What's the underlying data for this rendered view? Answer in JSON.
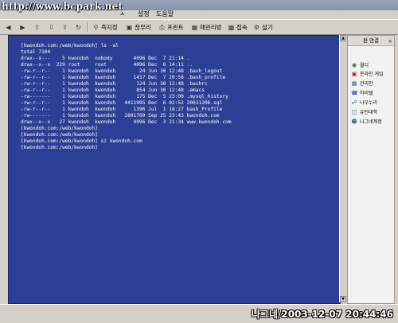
{
  "window": {
    "watermark": "http://www.bcpark.net"
  },
  "menu": [
    "ㅅ",
    "설정",
    "도움말"
  ],
  "toolbar": {
    "items": [
      {
        "icon": "back-arrow-icon",
        "label": ""
      },
      {
        "icon": "forward-arrow-icon",
        "label": ""
      },
      {
        "icon": "up-arrow-icon",
        "label": ""
      },
      {
        "icon": "download-icon",
        "label": ""
      },
      {
        "icon": "upload-icon",
        "label": ""
      },
      {
        "icon": "refresh-icon",
        "label": ""
      },
      {
        "icon": "connect-icon",
        "label": "즉지정"
      },
      {
        "icon": "disconnect-icon",
        "label": "끊무리"
      },
      {
        "icon": "print-icon",
        "label": "프린트"
      },
      {
        "icon": "manager-icon",
        "label": "매관리방"
      },
      {
        "icon": "terminal-icon",
        "label": "접속"
      },
      {
        "icon": "settings-icon",
        "label": "설기"
      }
    ]
  },
  "terminal": {
    "lines": [
      "[kwondoh.com:/web/kwondoh] ls -al",
      "total 7104",
      "drwx--x---    5 kwondoh  nobody       4096 Dec  7 21:14 .",
      "drwx--x--x  229 root     root         4096 Dec  6 14:11 ..",
      "-rw-r--r--    1 kwondoh  kwondoh        24 Jun 30 12:48 .bash_logout",
      "-rw-r--r--    1 kwondoh  kwondoh      1457 Dec  7 20:58 .bash_profile",
      "-rw-r--r--    1 kwondoh  kwondoh       124 Jun 30 12:48 .bashrc",
      "-rw-r--r--    1 kwondoh  kwondoh       854 Jun 30 12:48 .emacs",
      "-rw-------    1 kwondoh  kwondoh       175 Dec  5 23:00 .mysql_history",
      "-rw-r--r--    1 kwondoh  kwondoh   4411995 Dec  6 02:52 20031206.sql",
      "-rw-r--r--    1 kwondoh  kwondoh      1396 Jul  1 18:27 bash_Profile",
      "-rw-------    1 kwondoh  kwondoh   2801709 Sep 25 23:43 kwondoh.com",
      "drwx--x--x   27 kwondoh  kwondoh      4096 Dec  3 21:34 www.kwondoh.com",
      "[kwondoh.com:/web/kwondoh]",
      "[kwondoh.com:/web/kwondoh]",
      "[kwondoh.com:/web/kwondoh] sz kwondoh.com",
      "[kwondoh.com:/web/kwondoh]"
    ]
  },
  "sidebar": {
    "header": "편 연결",
    "close": "×",
    "items": [
      {
        "icon": "globe-icon",
        "label": "월디"
      },
      {
        "icon": "game-icon",
        "label": "온라인 게임"
      },
      {
        "icon": "manager-icon",
        "label": "관리안"
      },
      {
        "icon": "phone-icon",
        "label": "하이텔"
      },
      {
        "icon": "network-icon",
        "label": "나우누리"
      },
      {
        "icon": "folder-icon",
        "label": "유틴대학"
      },
      {
        "icon": "account-icon",
        "label": "나그네계정"
      }
    ]
  },
  "status": {
    "stamp": "나그네/2003-12-07 20:44:46"
  },
  "colors": {
    "terminal_bg": "#2c3f94",
    "terminal_fg": "#ffffff"
  }
}
